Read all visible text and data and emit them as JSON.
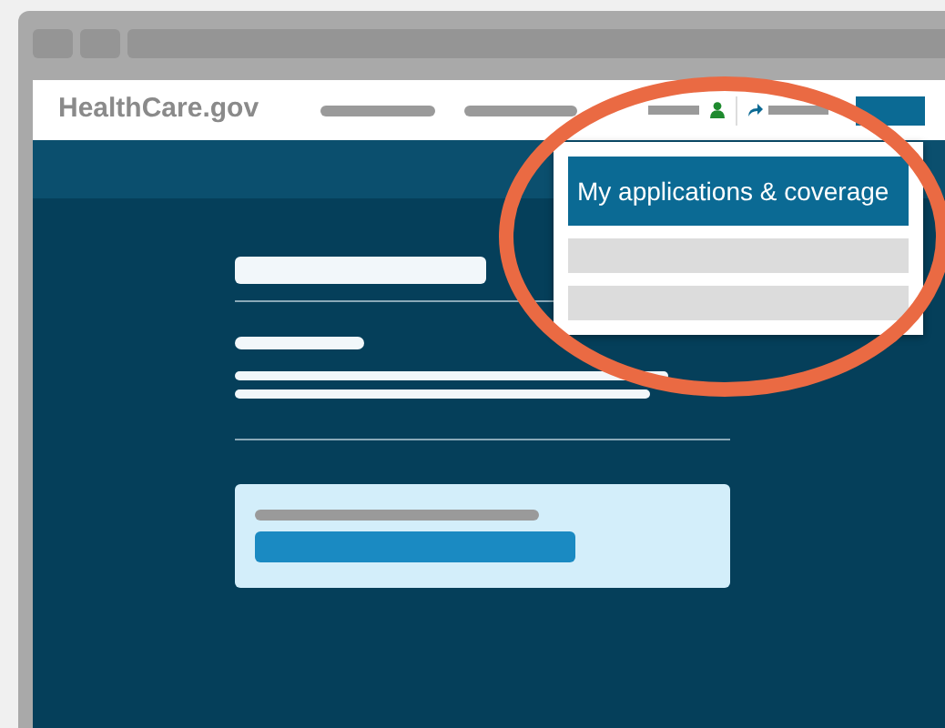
{
  "header": {
    "logo": "HealthCare.gov"
  },
  "account_menu": {
    "items": [
      {
        "kind": "link",
        "label": "My applications & coverage",
        "selected": true
      },
      {
        "kind": "placeholder",
        "selected": false
      },
      {
        "kind": "placeholder",
        "selected": false
      }
    ]
  }
}
